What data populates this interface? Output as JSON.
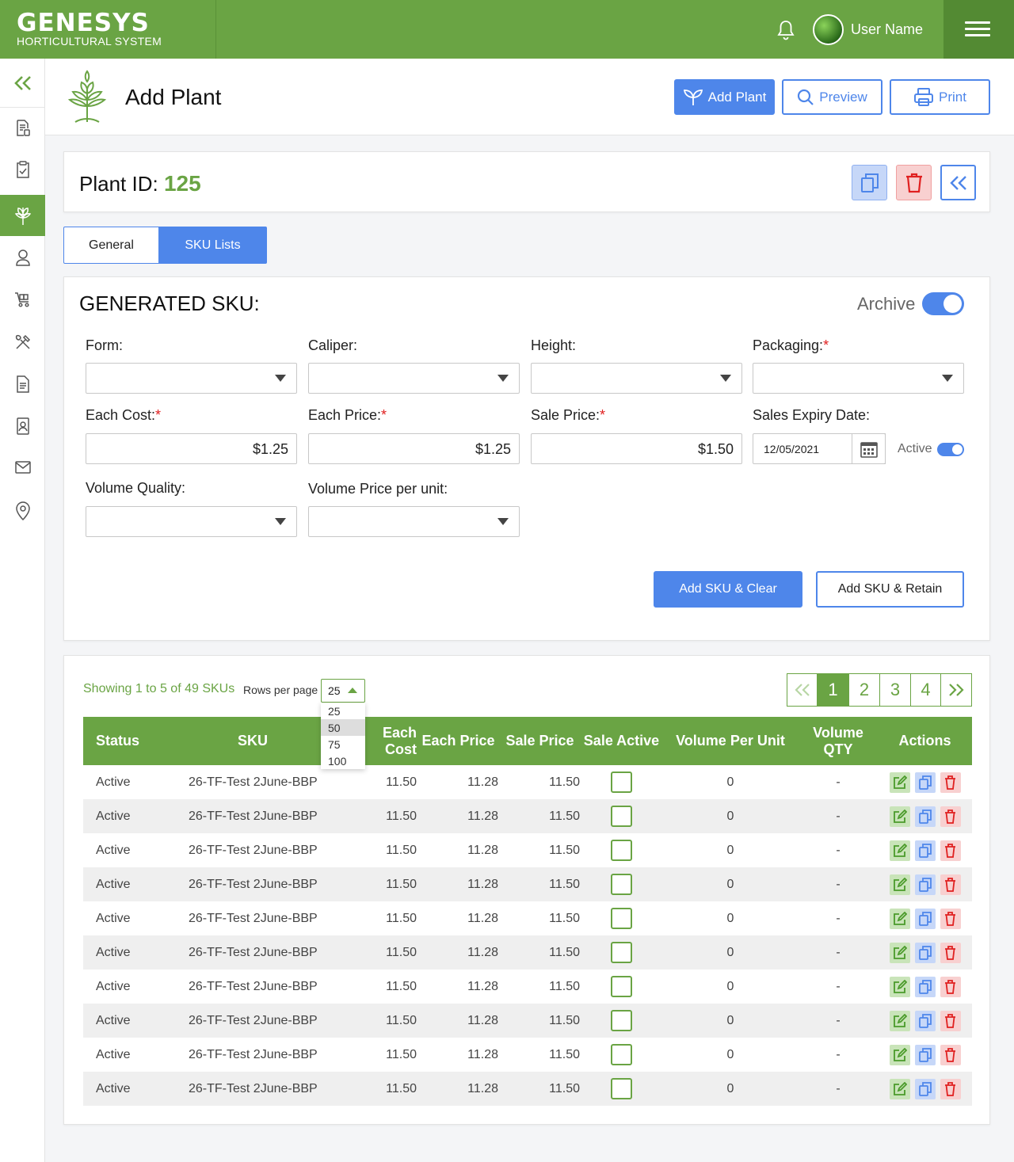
{
  "app": {
    "logo_main": "GENESYS",
    "logo_sub": "HORTICULTURAL SYSTEM",
    "username": "User Name"
  },
  "colors": {
    "brand_green": "#6aa444",
    "accent_blue": "#4e86ea",
    "danger_red": "#e02020"
  },
  "sidebar": {
    "items": [
      "collapse-icon",
      "report-icon",
      "clipboard-icon",
      "plant-icon",
      "user-icon",
      "cart-icon",
      "tools-icon",
      "document-icon",
      "contact-book-icon",
      "mail-icon",
      "location-pin-icon"
    ],
    "active": "plant-icon"
  },
  "header": {
    "title": "Add Plant",
    "add_plant_label": "Add Plant",
    "preview_label": "Preview",
    "print_label": "Print"
  },
  "plant": {
    "id_label": "Plant ID:",
    "id_value": "125"
  },
  "tabs": [
    {
      "label": "General",
      "active": false
    },
    {
      "label": "SKU Lists",
      "active": true
    }
  ],
  "sku_form": {
    "title": "GENERATED SKU:",
    "archive_label": "Archive",
    "archive_on": true,
    "form_label": "Form:",
    "caliper_label": "Caliper:",
    "height_label": "Height:",
    "packaging_label": "Packaging:",
    "each_cost_label": "Each Cost:",
    "each_cost_value": "$1.25",
    "each_price_label": "Each Price:",
    "each_price_value": "$1.25",
    "sale_price_label": "Sale Price:",
    "sale_price_value": "$1.50",
    "sales_expiry_label": "Sales Expiry Date:",
    "sales_expiry_value": "12/05/2021",
    "active_label": "Active",
    "active_on": true,
    "volume_quality_label": "Volume Quality:",
    "volume_price_label": "Volume Price per unit:",
    "required_mark": "*",
    "add_clear_label": "Add SKU & Clear",
    "add_retain_label": "Add SKU & Retain"
  },
  "list": {
    "showing": "Showing 1 to 5 of 49 SKUs",
    "rows_per_page_label": "Rows per page",
    "rows_per_page_value": "25",
    "rows_per_page_options": [
      "25",
      "50",
      "75",
      "100"
    ],
    "highlighted_option": "50",
    "pages": [
      "1",
      "2",
      "3",
      "4"
    ],
    "current_page": "1",
    "columns": [
      "Status",
      "SKU",
      "Each Cost",
      "Each Price",
      "Sale Price",
      "Sale Active",
      "Volume Per Unit",
      "Volume QTY",
      "Actions"
    ],
    "rows": [
      {
        "status": "Active",
        "sku": "26-TF-Test 2June-BBP",
        "each_cost": "11.50",
        "each_price": "11.28",
        "sale_price": "11.50",
        "sale_active": false,
        "volume_per_unit": "0",
        "volume_qty": "-"
      },
      {
        "status": "Active",
        "sku": "26-TF-Test 2June-BBP",
        "each_cost": "11.50",
        "each_price": "11.28",
        "sale_price": "11.50",
        "sale_active": false,
        "volume_per_unit": "0",
        "volume_qty": "-"
      },
      {
        "status": "Active",
        "sku": "26-TF-Test 2June-BBP",
        "each_cost": "11.50",
        "each_price": "11.28",
        "sale_price": "11.50",
        "sale_active": false,
        "volume_per_unit": "0",
        "volume_qty": "-"
      },
      {
        "status": "Active",
        "sku": "26-TF-Test 2June-BBP",
        "each_cost": "11.50",
        "each_price": "11.28",
        "sale_price": "11.50",
        "sale_active": false,
        "volume_per_unit": "0",
        "volume_qty": "-"
      },
      {
        "status": "Active",
        "sku": "26-TF-Test 2June-BBP",
        "each_cost": "11.50",
        "each_price": "11.28",
        "sale_price": "11.50",
        "sale_active": false,
        "volume_per_unit": "0",
        "volume_qty": "-"
      },
      {
        "status": "Active",
        "sku": "26-TF-Test 2June-BBP",
        "each_cost": "11.50",
        "each_price": "11.28",
        "sale_price": "11.50",
        "sale_active": false,
        "volume_per_unit": "0",
        "volume_qty": "-"
      },
      {
        "status": "Active",
        "sku": "26-TF-Test 2June-BBP",
        "each_cost": "11.50",
        "each_price": "11.28",
        "sale_price": "11.50",
        "sale_active": false,
        "volume_per_unit": "0",
        "volume_qty": "-"
      },
      {
        "status": "Active",
        "sku": "26-TF-Test 2June-BBP",
        "each_cost": "11.50",
        "each_price": "11.28",
        "sale_price": "11.50",
        "sale_active": false,
        "volume_per_unit": "0",
        "volume_qty": "-"
      },
      {
        "status": "Active",
        "sku": "26-TF-Test 2June-BBP",
        "each_cost": "11.50",
        "each_price": "11.28",
        "sale_price": "11.50",
        "sale_active": false,
        "volume_per_unit": "0",
        "volume_qty": "-"
      },
      {
        "status": "Active",
        "sku": "26-TF-Test 2June-BBP",
        "each_cost": "11.50",
        "each_price": "11.28",
        "sale_price": "11.50",
        "sale_active": false,
        "volume_per_unit": "0",
        "volume_qty": "-"
      }
    ]
  }
}
